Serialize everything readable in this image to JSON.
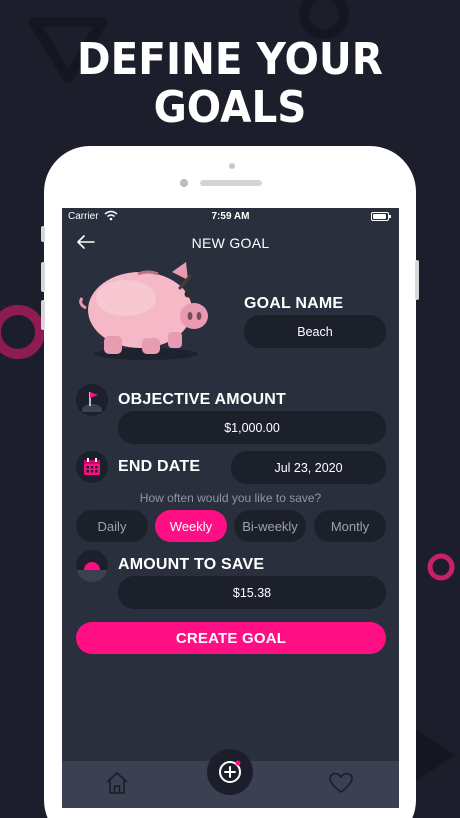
{
  "headline": [
    "DEFINE YOUR",
    "GOALS"
  ],
  "status_bar": {
    "carrier": "Carrier",
    "time": "7:59 AM"
  },
  "nav": {
    "title": "NEW GOAL"
  },
  "goal_name": {
    "label": "GOAL NAME",
    "value": "Beach"
  },
  "objective_amount": {
    "label": "OBJECTIVE AMOUNT",
    "value": "$1,000.00"
  },
  "end_date": {
    "label": "END DATE",
    "value": "Jul 23, 2020"
  },
  "frequency": {
    "question": "How often would you like to save?",
    "options": [
      "Daily",
      "Weekly",
      "Bi-weekly",
      "Montly"
    ],
    "selected": "Weekly"
  },
  "amount_to_save": {
    "label": "AMOUNT TO SAVE",
    "value": "$15.38"
  },
  "create_button": "CREATE GOAL",
  "tabs": [
    "home-icon",
    "add-goal-icon",
    "heart-icon"
  ],
  "colors": {
    "accent": "#ff0e84",
    "background": "#1c1f2b",
    "screen": "#2a2f3e",
    "field": "#1c202b",
    "tabbar": "#3b4152"
  }
}
